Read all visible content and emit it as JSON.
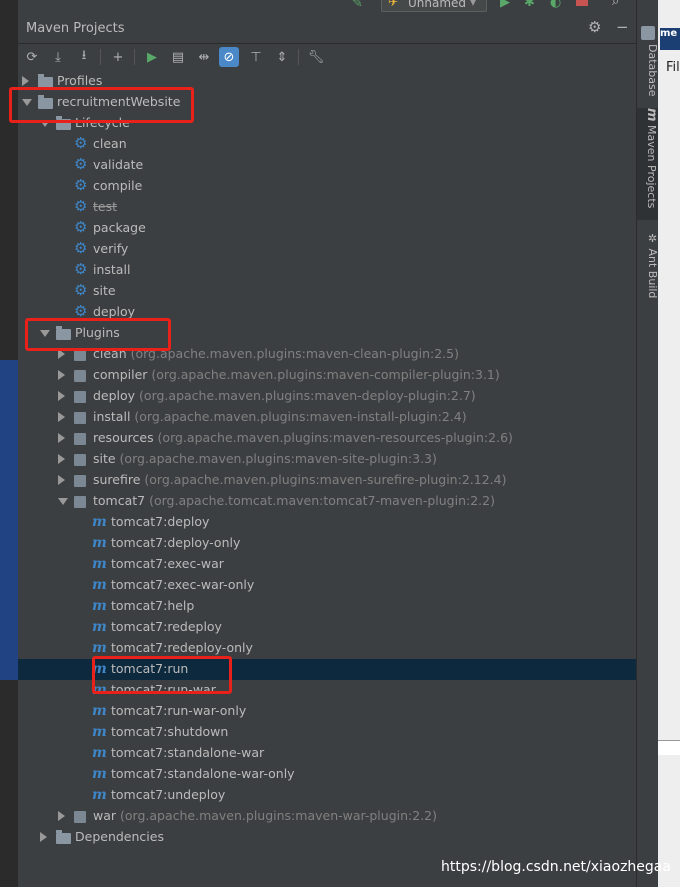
{
  "run_config": {
    "label": "Unnamed"
  },
  "panel": {
    "title": "Maven Projects"
  },
  "side_tabs": [
    "Database",
    "Maven Projects",
    "Ant Build"
  ],
  "right_app": {
    "menu_fragment": "Fil"
  },
  "toolbar_icons": [
    "refresh-icon",
    "reimport-icon",
    "download-icon",
    "add-icon",
    "run-icon",
    "execute-goal-icon",
    "toggle-offline-icon",
    "skip-tests-icon",
    "show-dependencies-icon",
    "collapse-all-icon",
    "settings-wrench-icon"
  ],
  "tree": {
    "profiles": "Profiles",
    "project": "recruitmentWebsite",
    "lifecycle": "Lifecycle",
    "lifecycle_goals": [
      "clean",
      "validate",
      "compile",
      "test",
      "package",
      "verify",
      "install",
      "site",
      "deploy"
    ],
    "plugins_label": "Plugins",
    "plugins": [
      {
        "name": "clean",
        "coord": "(org.apache.maven.plugins:maven-clean-plugin:2.5)"
      },
      {
        "name": "compiler",
        "coord": "(org.apache.maven.plugins:maven-compiler-plugin:3.1)"
      },
      {
        "name": "deploy",
        "coord": "(org.apache.maven.plugins:maven-deploy-plugin:2.7)"
      },
      {
        "name": "install",
        "coord": "(org.apache.maven.plugins:maven-install-plugin:2.4)"
      },
      {
        "name": "resources",
        "coord": "(org.apache.maven.plugins:maven-resources-plugin:2.6)"
      },
      {
        "name": "site",
        "coord": "(org.apache.maven.plugins:maven-site-plugin:3.3)"
      },
      {
        "name": "surefire",
        "coord": "(org.apache.maven.plugins:maven-surefire-plugin:2.12.4)"
      },
      {
        "name": "tomcat7",
        "coord": "(org.apache.tomcat.maven:tomcat7-maven-plugin:2.2)"
      }
    ],
    "tomcat_goals": [
      "tomcat7:deploy",
      "tomcat7:deploy-only",
      "tomcat7:exec-war",
      "tomcat7:exec-war-only",
      "tomcat7:help",
      "tomcat7:redeploy",
      "tomcat7:redeploy-only",
      "tomcat7:run",
      "tomcat7:run-war",
      "tomcat7:run-war-only",
      "tomcat7:shutdown",
      "tomcat7:standalone-war",
      "tomcat7:standalone-war-only",
      "tomcat7:undeploy"
    ],
    "war_plugin": {
      "name": "war",
      "coord": "(org.apache.maven.plugins:maven-war-plugin:2.2)"
    },
    "dependencies": "Dependencies"
  },
  "watermark": "https://blog.csdn.net/xiaozhegaa"
}
